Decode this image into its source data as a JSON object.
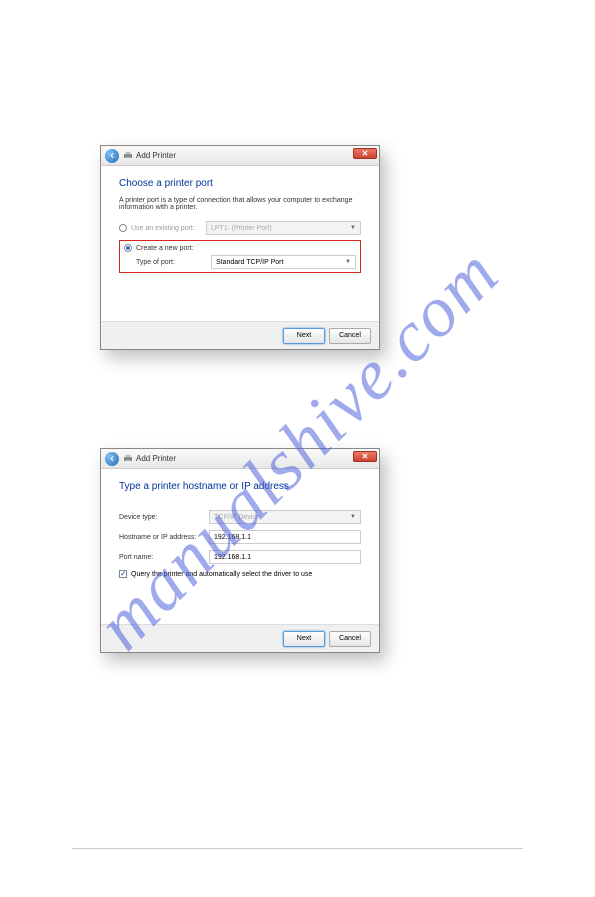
{
  "watermark": "manualshive.com",
  "dialog1": {
    "title": "Add Printer",
    "heading": "Choose a printer port",
    "subtext": "A printer port is a type of connection that allows your computer to exchange information with a printer.",
    "use_existing_label": "Use an existing port:",
    "existing_port_value": "LPT1: (Printer Port)",
    "create_new_label": "Create a new port:",
    "type_of_port_label": "Type of port:",
    "type_of_port_value": "Standard TCP/IP Port",
    "next_label": "Next",
    "cancel_label": "Cancel"
  },
  "dialog2": {
    "title": "Add Printer",
    "heading": "Type a printer hostname or IP address",
    "device_type_label": "Device type:",
    "device_type_value": "TCP/IP Device",
    "hostname_label": "Hostname or IP address:",
    "hostname_value": "192.168.1.1",
    "port_name_label": "Port name:",
    "port_name_value": "192.168.1.1",
    "query_label": "Query the printer and automatically select the driver to use",
    "next_label": "Next",
    "cancel_label": "Cancel"
  }
}
